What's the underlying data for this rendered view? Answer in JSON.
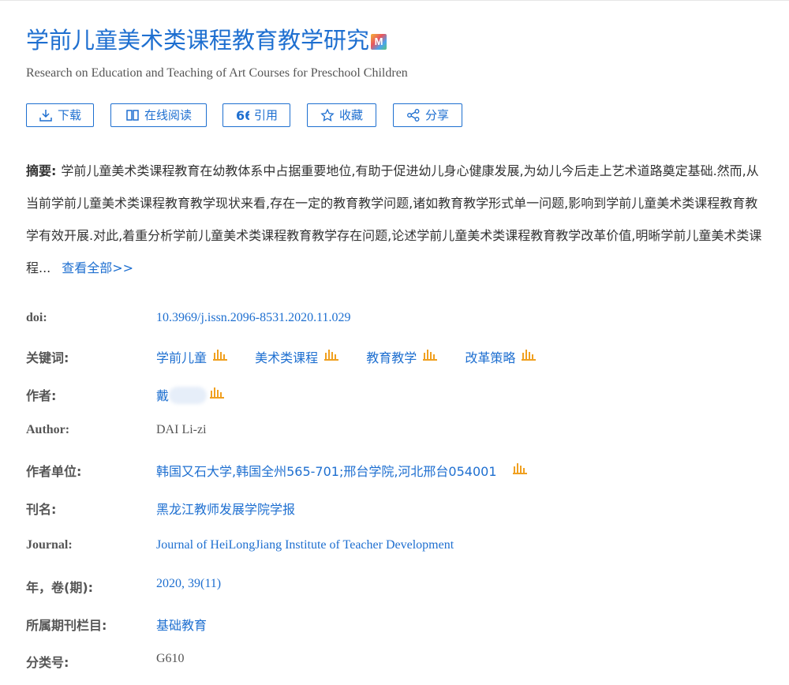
{
  "title": "学前儿童美术类课程教育教学研究",
  "title_badge": "M",
  "subtitle": "Research on Education and Teaching of Art Courses for Preschool Children",
  "toolbar": {
    "download": "下载",
    "read_online": "在线阅读",
    "cite": "引用",
    "favorite": "收藏",
    "share": "分享"
  },
  "abstract": {
    "label": "摘要:",
    "text": "学前儿童美术类课程教育在幼教体系中占据重要地位,有助于促进幼儿身心健康发展,为幼儿今后走上艺术道路奠定基础.然而,从当前学前儿童美术类课程教育教学现状来看,存在一定的教育教学问题,诸如教育教学形式单一问题,影响到学前儿童美术类课程教育教学有效开展.对此,着重分析学前儿童美术类课程教育教学存在问题,论述学前儿童美术类课程教育教学改革价值,明晰学前儿童美术类课程...",
    "more": "查看全部>>"
  },
  "meta": {
    "doi_label": "doi:",
    "doi": "10.3969/j.issn.2096-8531.2020.11.029",
    "keywords_label": "关键词:",
    "keywords": [
      "学前儿童",
      "美术类课程",
      "教育教学",
      "改革策略"
    ],
    "author_label": "作者:",
    "author": "戴",
    "author_en_label": "Author:",
    "author_en": "DAI Li-zi",
    "affiliation_label": "作者单位:",
    "affiliation": "韩国又石大学,韩国全州565-701;邢台学院,河北邢台054001",
    "journal_label": "刊名:",
    "journal": "黑龙江教师发展学院学报",
    "journal_en_label": "Journal:",
    "journal_en": "Journal of HeiLongJiang Institute of Teacher Development",
    "year_label": "年，卷(期):",
    "year": "2020, 39(11)",
    "column_label": "所属期刊栏目:",
    "column": "基础教育",
    "class_label": "分类号:",
    "class": "G610"
  },
  "colors": {
    "link": "#1e6fd0",
    "chart_icon": "#f0a020"
  }
}
